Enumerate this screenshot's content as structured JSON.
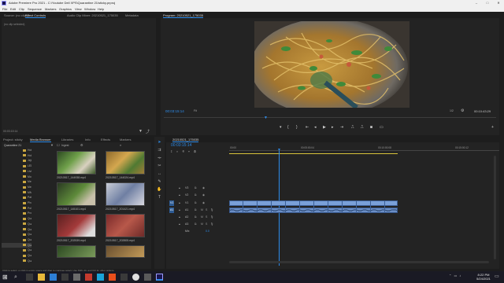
{
  "window": {
    "title": "Adobe Premiere Pro 2021 - C:\\Youtube Dell XPS\\Quarantine 21\\sticky.prproj"
  },
  "menu": [
    "File",
    "Edit",
    "Clip",
    "Sequence",
    "Markers",
    "Graphics",
    "View",
    "Window",
    "Help"
  ],
  "source_panel": {
    "tabs": [
      "Source: (no clips)",
      "Effect Controls",
      "Audio Clip Mixer: 20210521_175035",
      "Metadata"
    ],
    "active_tab": 1,
    "message": "(no clip selected)",
    "timecode": "00:03:15:14"
  },
  "program": {
    "title": "Program: 20210521_175035",
    "timecode": "00:03:15:14",
    "fit": "Fit",
    "quality": "1/2",
    "duration": "00:10:43:29"
  },
  "project": {
    "tabs": [
      "Project: sticky",
      "Media Browser",
      "Libraries",
      "Info",
      "Effects",
      "Markers"
    ],
    "active_tab": 1,
    "location": "Quarantine 21",
    "ingest_label": "Ingest",
    "folders": [
      "Hot Pot",
      "Hol Pero",
      "Jeju Float",
      "LED Mask",
      "Living Conditions",
      "Mondo",
      "Meal Prep 4",
      "Meal Prep 10",
      "MMP Comes 2",
      "Patreon Trailer",
      "Phone App Review",
      "Police Highway",
      "ProTeam Brush",
      "Quarantine 11",
      "Quarantine 17",
      "Quarantine 18",
      "Quarantine 19",
      "Quarantine 20",
      "Quarantine 21",
      "Quarantine 22",
      "Quarantine Cooking",
      "Quarantine Fox"
    ],
    "selected_folder": 18,
    "media": [
      {
        "name": "20210517_144938.mp4",
        "duration": "2:13"
      },
      {
        "name": "20210517_144024.mp4",
        "duration": "0:14"
      },
      {
        "name": "20210517_145101.mp4",
        "duration": "0:41"
      },
      {
        "name": "20210517_201421.mp4",
        "duration": "0:10"
      },
      {
        "name": "20210517_202539.mp4",
        "duration": "0:52"
      },
      {
        "name": "20210517_202805.mp4",
        "duration": "0:19"
      }
    ]
  },
  "timeline": {
    "sequence": "20210521_175035",
    "timecode": "00:03:15:14",
    "ruler": [
      "00:00",
      "00:05:00:04",
      "00:10:00:08",
      "00:15:00:12"
    ],
    "video_tracks": [
      "V3",
      "V2",
      "V1"
    ],
    "audio_tracks": [
      "A1",
      "A2",
      "A3"
    ],
    "master": "Mix",
    "master_value": "0.0"
  },
  "status": {
    "hint": "Click to select, or click in empty space and drag to marquee select. Use Shift, Alt, and Ctrl for other options."
  },
  "taskbar": {
    "time": "8:22 PM",
    "date": "5/24/2021"
  },
  "colors": {
    "accent": "#2d8ceb",
    "clip": "#7aa0d8",
    "audio_clip": "#6b8fc7",
    "playhead": "#2d8ceb"
  }
}
